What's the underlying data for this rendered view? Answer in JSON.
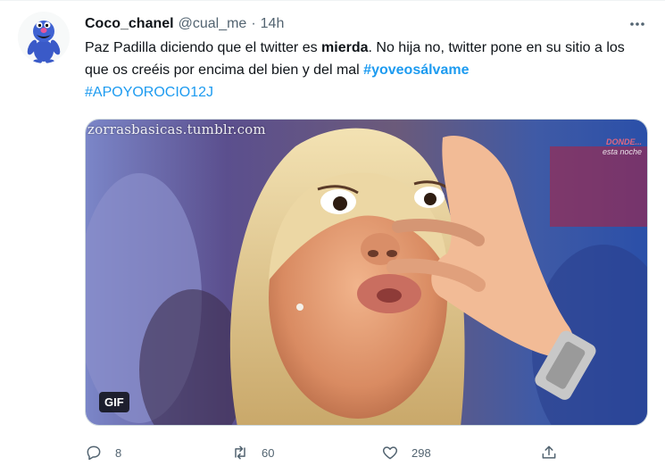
{
  "tweet": {
    "display_name": "Coco_chanel",
    "handle": "@cual_me",
    "separator": "·",
    "time": "14h",
    "text": {
      "part1": "Paz Padilla diciendo que el twitter es ",
      "bold": "mierda",
      "part2": ". No hija no, twitter pone en su sitio a los que os creéis por encima del bien y del mal ",
      "hashtag1": "#yoveosálvame",
      "hashtag2": "#APOYOROCIO12J"
    },
    "media": {
      "watermark": "zorrasbasicas.tumblr.com",
      "overlay_line1": "DONDE...",
      "overlay_line2": "esta noche",
      "badge": "GIF"
    },
    "actions": {
      "replies": "8",
      "retweets": "60",
      "likes": "298"
    }
  },
  "colors": {
    "accent": "#1d9bf0",
    "text": "#0f1419",
    "secondary": "#536471"
  },
  "icons": [
    "grover-avatar",
    "more-icon",
    "reply-icon",
    "retweet-icon",
    "like-icon",
    "share-icon"
  ]
}
